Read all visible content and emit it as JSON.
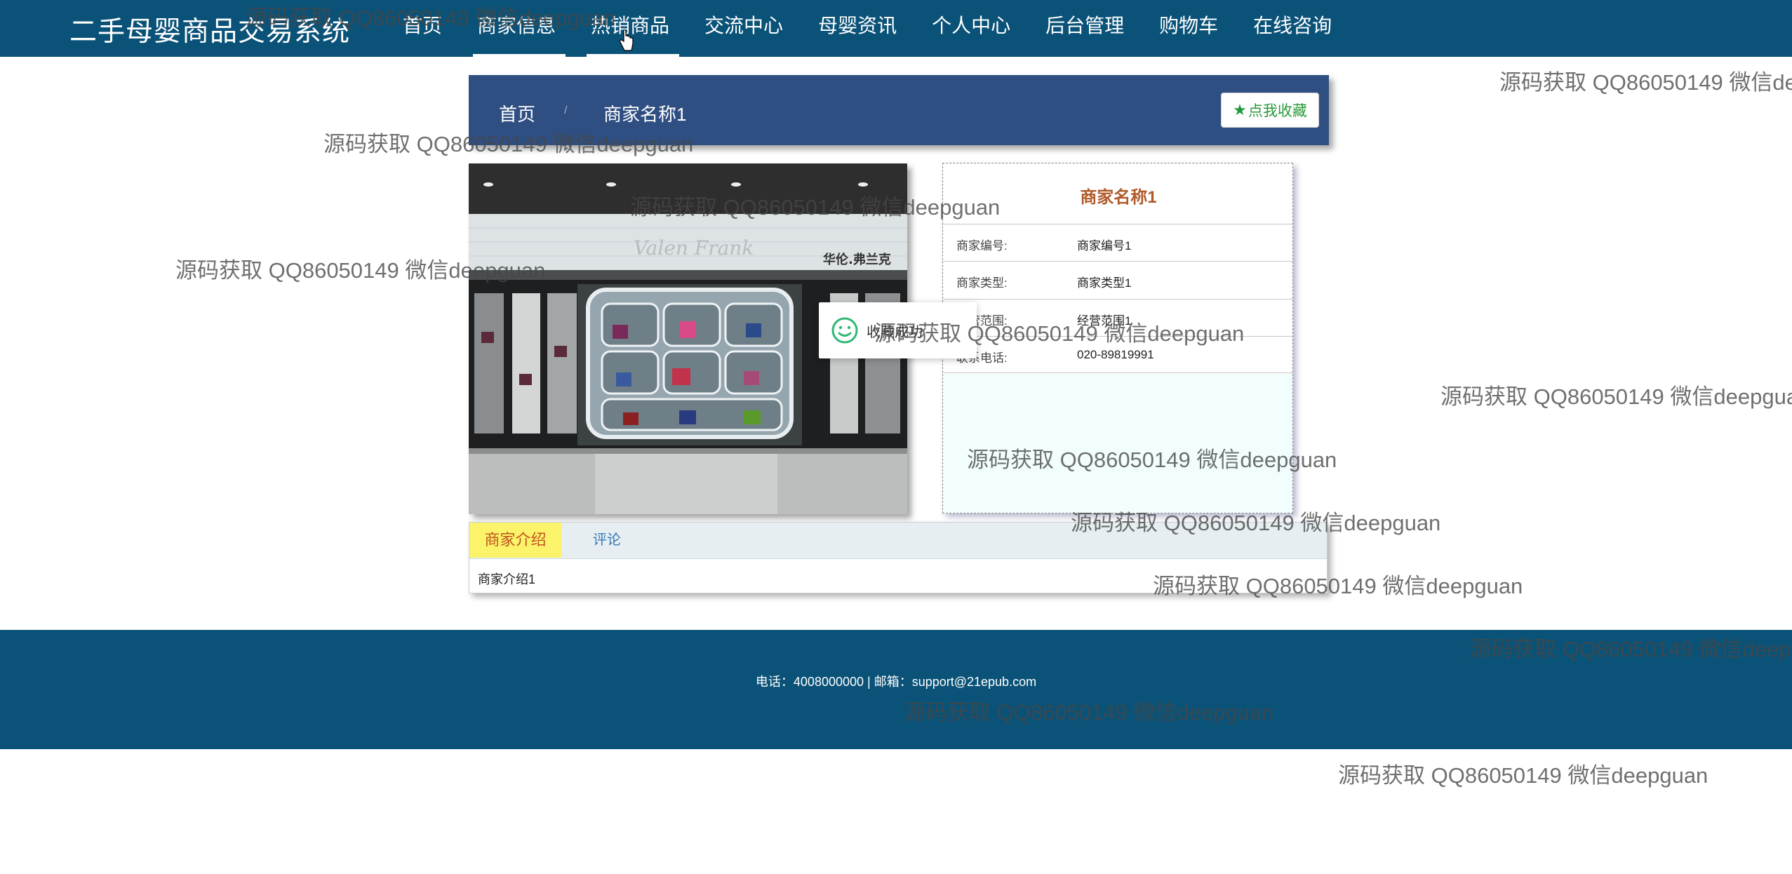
{
  "app": {
    "title": "二手母婴商品交易系统"
  },
  "nav": {
    "items": [
      {
        "label": "首页"
      },
      {
        "label": "商家信息"
      },
      {
        "label": "热销商品"
      },
      {
        "label": "交流中心"
      },
      {
        "label": "母婴资讯"
      },
      {
        "label": "个人中心"
      },
      {
        "label": "后台管理"
      },
      {
        "label": "购物车"
      },
      {
        "label": "在线咨询"
      }
    ]
  },
  "breadcrumb": {
    "home": "首页",
    "separator": "/",
    "current": "商家名称1"
  },
  "favorite_button": {
    "icon": "star-icon",
    "label": "点我收藏"
  },
  "store_image": {
    "sign_text": "华伦.弗兰克",
    "logo_text": "Valen Frank"
  },
  "merchant": {
    "name": "商家名称1",
    "fields": [
      {
        "key": "商家编号:",
        "value": "商家编号1"
      },
      {
        "key": "商家类型:",
        "value": "商家类型1"
      },
      {
        "key": "经营范围:",
        "value": "经营范围1"
      },
      {
        "key": "联系电话:",
        "value": "020-89819991"
      }
    ]
  },
  "toast": {
    "icon": "smile-icon",
    "text": "收藏成功"
  },
  "tabs": {
    "items": [
      {
        "label": "商家介绍",
        "active": true
      },
      {
        "label": "评论",
        "active": false
      }
    ],
    "content": "商家介绍1"
  },
  "footer": {
    "text": "电话：4008000000 | 邮箱：support@21epub.com"
  },
  "watermark": {
    "text": "源码获取 QQ86050149 微信deepguan"
  },
  "colors": {
    "nav_bg": "#0a5278",
    "breadcrumb_bg": "#2f4f82",
    "title_accent": "#b05a2a",
    "active_tab_bg": "#fbf46a"
  }
}
